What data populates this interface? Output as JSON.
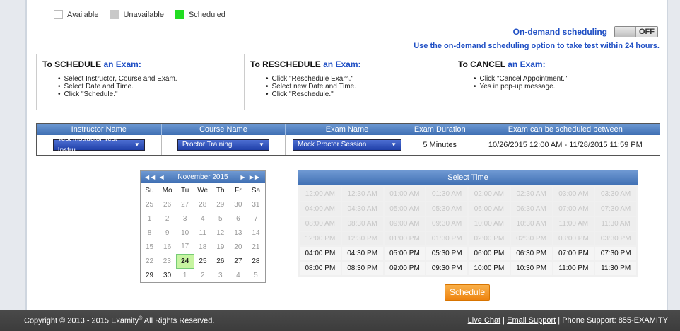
{
  "legend": {
    "available": "Available",
    "unavailable": "Unavailable",
    "scheduled": "Scheduled"
  },
  "on_demand": {
    "label": "On-demand scheduling",
    "toggle": "OFF",
    "note": "Use the on-demand scheduling option to take test within 24 hours."
  },
  "instructions": [
    {
      "prefix": "To ",
      "verb": "SCHEDULE",
      "suffix": " an Exam:",
      "items": [
        "Select Instructor, Course and Exam.",
        "Select Date and Time.",
        "Click \"Schedule.\""
      ]
    },
    {
      "prefix": "To ",
      "verb": "RESCHEDULE",
      "suffix": " an Exam:",
      "items": [
        "Click \"Reschedule Exam.\"",
        "Select new Date and Time.",
        "Click \"Reschedule.\""
      ]
    },
    {
      "prefix": "To ",
      "verb": "CANCEL",
      "suffix": " an Exam:",
      "items": [
        "Click \"Cancel Appointment.\"",
        "Yes in pop-up message."
      ]
    }
  ],
  "exam_grid": {
    "headers": [
      "Instructor Name",
      "Course Name",
      "Exam Name",
      "Exam Duration",
      "Exam can be scheduled between"
    ],
    "instructor": "Test Instructor Test Instru",
    "course": "Proctor Training",
    "exam": "Mock Proctor Session",
    "duration": "5 Minutes",
    "window_start": "10/26/2015 12:00 AM",
    "window_sep": " - ",
    "window_end": "11/28/2015 11:59 PM"
  },
  "calendar": {
    "month": "November 2015",
    "nav_prev": "◀◀  ◀",
    "nav_next": "▶  ▶▶",
    "weekdays": [
      "Su",
      "Mo",
      "Tu",
      "We",
      "Th",
      "Fr",
      "Sa"
    ],
    "weeks": [
      [
        "25",
        "26",
        "27",
        "28",
        "29",
        "30",
        "31"
      ],
      [
        "1",
        "2",
        "3",
        "4",
        "5",
        "6",
        "7"
      ],
      [
        "8",
        "9",
        "10",
        "11",
        "12",
        "13",
        "14"
      ],
      [
        "15",
        "16",
        "17",
        "18",
        "19",
        "20",
        "21"
      ],
      [
        "22",
        "23",
        "24",
        "25",
        "26",
        "27",
        "28"
      ],
      [
        "29",
        "30",
        "1",
        "2",
        "3",
        "4",
        "5"
      ]
    ],
    "selected": "24"
  },
  "time_select": {
    "title": "Select Time",
    "slots": [
      "12:00 AM",
      "12:30 AM",
      "01:00 AM",
      "01:30 AM",
      "02:00 AM",
      "02:30 AM",
      "03:00 AM",
      "03:30 AM",
      "04:00 AM",
      "04:30 AM",
      "05:00 AM",
      "05:30 AM",
      "06:00 AM",
      "06:30 AM",
      "07:00 AM",
      "07:30 AM",
      "08:00 AM",
      "08:30 AM",
      "09:00 AM",
      "09:30 AM",
      "10:00 AM",
      "10:30 AM",
      "11:00 AM",
      "11:30 AM",
      "12:00 PM",
      "12:30 PM",
      "01:00 PM",
      "01:30 PM",
      "02:00 PM",
      "02:30 PM",
      "03:00 PM",
      "03:30 PM",
      "04:00 PM",
      "04:30 PM",
      "05:00 PM",
      "05:30 PM",
      "06:00 PM",
      "06:30 PM",
      "07:00 PM",
      "07:30 PM",
      "08:00 PM",
      "08:30 PM",
      "09:00 PM",
      "09:30 PM",
      "10:00 PM",
      "10:30 PM",
      "11:00 PM",
      "11:30 PM"
    ],
    "first_available_index": 32
  },
  "schedule_button": "Schedule",
  "footer": {
    "copyright": "Copyright © 2013 - 2015 Examity",
    "registered": "®",
    "rights": " All Rights Reserved.",
    "live_chat": "Live Chat",
    "email_support": "Email Support",
    "separator": " | ",
    "phone": "Phone Support: 855-EXAMITY"
  },
  "colors": {
    "accent_blue": "#1f4fc4",
    "header_blue": "#3f6fb3",
    "scheduled_green": "#22dd22",
    "button_orange": "#ee8410"
  }
}
